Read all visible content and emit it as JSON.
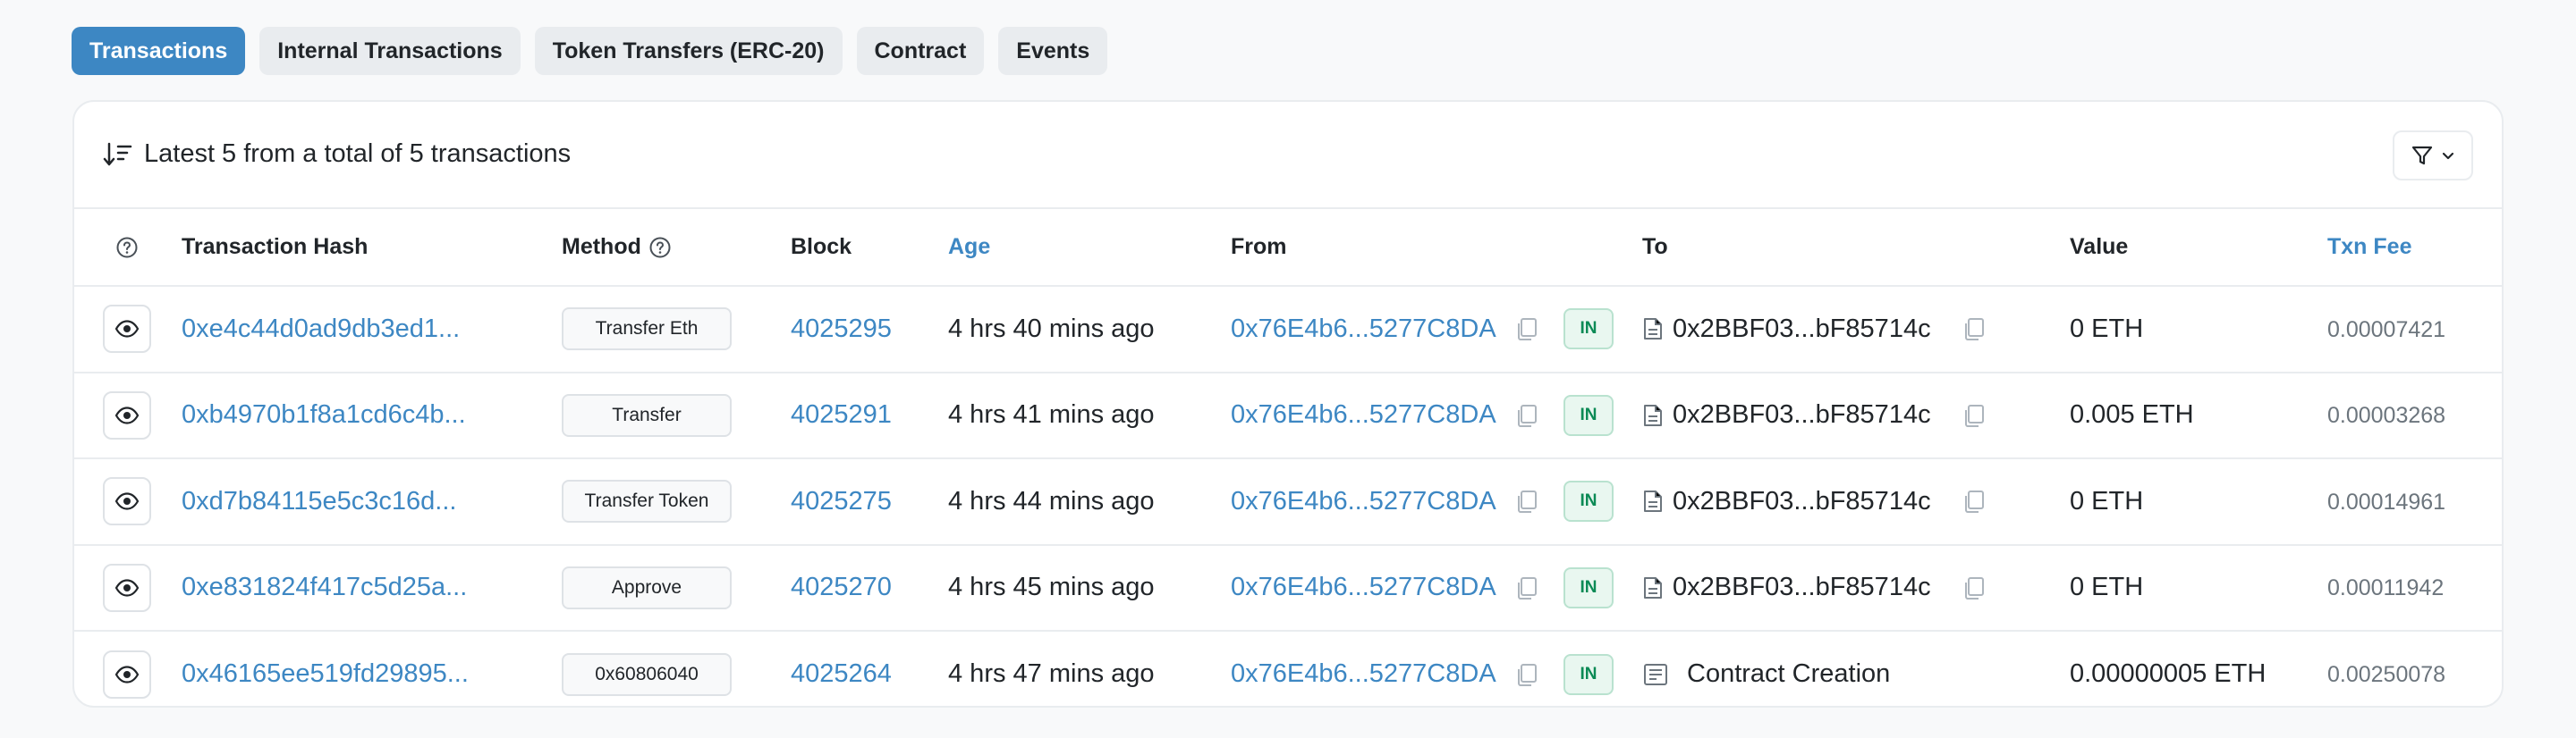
{
  "tabs": [
    {
      "label": "Transactions",
      "active": true
    },
    {
      "label": "Internal Transactions",
      "active": false
    },
    {
      "label": "Token Transfers (ERC-20)",
      "active": false
    },
    {
      "label": "Contract",
      "active": false
    },
    {
      "label": "Events",
      "active": false
    }
  ],
  "summary": "Latest 5 from a total of 5 transactions",
  "columns": {
    "hash": "Transaction Hash",
    "method": "Method",
    "block": "Block",
    "age": "Age",
    "from": "From",
    "to": "To",
    "value": "Value",
    "fee": "Txn Fee"
  },
  "rows": [
    {
      "hash": "0xe4c44d0ad9db3ed1...",
      "method": "Transfer Eth",
      "block": "4025295",
      "age": "4 hrs 40 mins ago",
      "from": "0x76E4b6...5277C8DA",
      "direction": "IN",
      "to": "0x2BBF03...bF85714c",
      "to_type": "contract",
      "value": "0 ETH",
      "fee": "0.00007421"
    },
    {
      "hash": "0xb4970b1f8a1cd6c4b...",
      "method": "Transfer",
      "block": "4025291",
      "age": "4 hrs 41 mins ago",
      "from": "0x76E4b6...5277C8DA",
      "direction": "IN",
      "to": "0x2BBF03...bF85714c",
      "to_type": "contract",
      "value": "0.005 ETH",
      "fee": "0.00003268"
    },
    {
      "hash": "0xd7b84115e5c3c16d...",
      "method": "Transfer Token",
      "block": "4025275",
      "age": "4 hrs 44 mins ago",
      "from": "0x76E4b6...5277C8DA",
      "direction": "IN",
      "to": "0x2BBF03...bF85714c",
      "to_type": "contract",
      "value": "0 ETH",
      "fee": "0.00014961"
    },
    {
      "hash": "0xe831824f417c5d25a...",
      "method": "Approve",
      "block": "4025270",
      "age": "4 hrs 45 mins ago",
      "from": "0x76E4b6...5277C8DA",
      "direction": "IN",
      "to": "0x2BBF03...bF85714c",
      "to_type": "contract",
      "value": "0 ETH",
      "fee": "0.00011942"
    },
    {
      "hash": "0x46165ee519fd29895...",
      "method": "0x60806040",
      "block": "4025264",
      "age": "4 hrs 47 mins ago",
      "from": "0x76E4b6...5277C8DA",
      "direction": "IN",
      "to": "Contract Creation",
      "to_type": "creation",
      "value": "0.00000005 ETH",
      "fee": "0.00250078"
    }
  ],
  "colors": {
    "accent": "#3d87c3",
    "in_badge_bg": "#e9f7f0",
    "in_badge_text": "#0b8a55"
  }
}
